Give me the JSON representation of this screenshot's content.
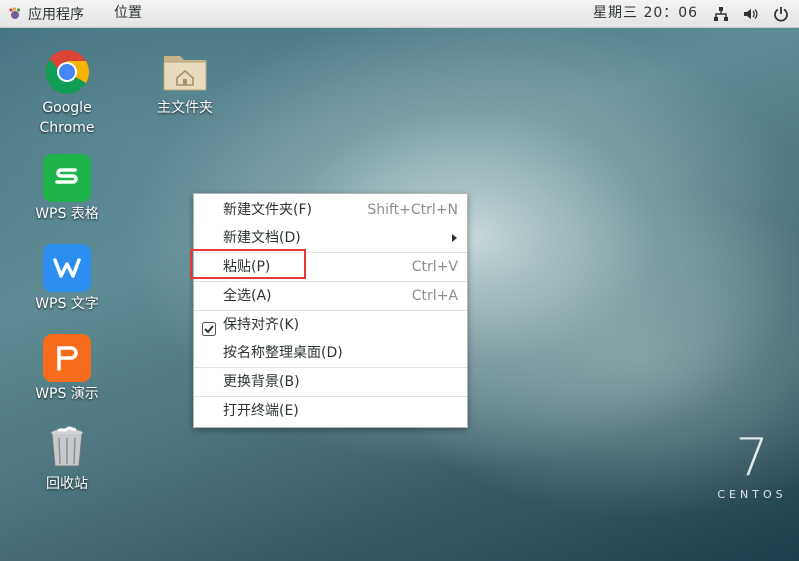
{
  "top_bar": {
    "applications_label": "应用程序",
    "places_label": "位置",
    "clock": "星期三 20：06",
    "tray_icons": [
      "network-icon",
      "volume-icon",
      "power-icon"
    ]
  },
  "desktop_icons": [
    {
      "label_line1": "Google",
      "label_line2": "Chrome",
      "icon": "chrome-icon"
    },
    {
      "label_line1": "主文件夹",
      "icon": "home-folder-icon"
    },
    {
      "label_line1": "WPS 表格",
      "icon": "wps-spreadsheet-icon"
    },
    {
      "label_line1": "WPS 文字",
      "icon": "wps-writer-icon"
    },
    {
      "label_line1": "WPS 演示",
      "icon": "wps-presentation-icon"
    },
    {
      "label_line1": "回收站",
      "icon": "trash-icon"
    }
  ],
  "context_menu": {
    "items": [
      {
        "label": "新建文件夹(F)",
        "accel": "Shift+Ctrl+N"
      },
      {
        "label": "新建文档(D)",
        "submenu": true
      },
      {
        "label": "粘贴(P)",
        "accel": "Ctrl+V",
        "highlighted": true
      },
      {
        "label": "全选(A)",
        "accel": "Ctrl+A"
      },
      {
        "label": "保持对齐(K)",
        "checked": true
      },
      {
        "label": "按名称整理桌面(D)"
      },
      {
        "label": "更换背景(B)"
      },
      {
        "label": "打开终端(E)"
      }
    ]
  },
  "branding": {
    "version": "7",
    "name": "CENTOS"
  },
  "colors": {
    "highlight_border": "#e53935",
    "wps_spreadsheet": "#1fb34b",
    "wps_writer": "#2b8ef0",
    "wps_presentation": "#f76b1c"
  }
}
